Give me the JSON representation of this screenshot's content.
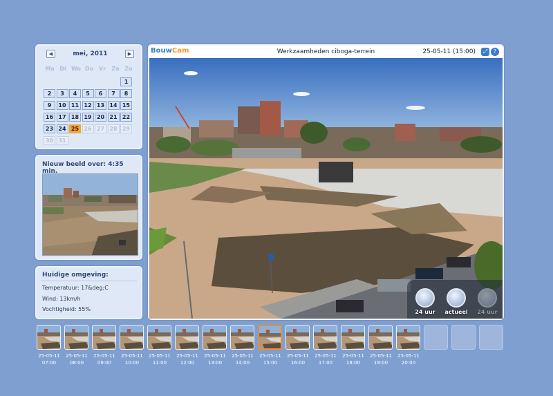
{
  "calendar": {
    "month_label": "mei, 2011",
    "prev_icon": "chevron-left-icon",
    "next_icon": "chevron-right-icon",
    "weekdays": [
      "Ma",
      "Di",
      "Wo",
      "Do",
      "Vr",
      "Za",
      "Zo"
    ],
    "weeks": [
      [
        "",
        "",
        "",
        "",
        "",
        "",
        "1"
      ],
      [
        "2",
        "3",
        "4",
        "5",
        "6",
        "7",
        "8"
      ],
      [
        "9",
        "10",
        "11",
        "12",
        "13",
        "14",
        "15"
      ],
      [
        "16",
        "17",
        "18",
        "19",
        "20",
        "21",
        "22"
      ],
      [
        "23",
        "24",
        "25",
        "26",
        "27",
        "28",
        "29"
      ],
      [
        "30",
        "31",
        "",
        "",
        "",
        "",
        ""
      ]
    ],
    "selected_day": "25",
    "today_color": "#f7a33c"
  },
  "countdown": {
    "label": "Nieuw beeld over: 4:35 min."
  },
  "environment": {
    "title": "Huidige omgeving:",
    "temperature": "Temperatuur: 17&deg;C",
    "wind": "Wind: 13km/h",
    "humidity": "Vochtigheid: 55%"
  },
  "main": {
    "logo_part1": "Bouw",
    "logo_part2": "Cam",
    "title": "Werkzaamheden ciboga-terrein",
    "timestamp": "25-05-11 (15:00)",
    "expand_icon": "expand-icon",
    "help_icon": "help-icon",
    "controls": [
      {
        "icon": "clock-24h-icon",
        "label": "24 uur"
      },
      {
        "icon": "download-current-icon",
        "label": "actueel"
      },
      {
        "icon": "clock-24h-disabled-icon",
        "label": "24 uur"
      }
    ],
    "brand_colors": {
      "blue": "#2f82c6",
      "orange": "#f59a24"
    }
  },
  "filmstrip": [
    {
      "date": "25-05-11",
      "time": "07:00"
    },
    {
      "date": "25-05-11",
      "time": "08:00"
    },
    {
      "date": "25-05-11",
      "time": "09:00"
    },
    {
      "date": "25-05-11",
      "time": "10:00"
    },
    {
      "date": "25-05-11",
      "time": "11:00"
    },
    {
      "date": "25-05-11",
      "time": "12:00"
    },
    {
      "date": "25-05-11",
      "time": "13:00"
    },
    {
      "date": "25-05-11",
      "time": "14:00"
    },
    {
      "date": "25-05-11",
      "time": "15:00"
    },
    {
      "date": "25-05-11",
      "time": "16:00"
    },
    {
      "date": "25-05-11",
      "time": "17:00"
    },
    {
      "date": "25-05-11",
      "time": "18:00"
    },
    {
      "date": "25-05-11",
      "time": "19:00"
    },
    {
      "date": "25-05-11",
      "time": "20:00"
    }
  ],
  "selected_thumb": "15:00",
  "empty_slots": 3
}
